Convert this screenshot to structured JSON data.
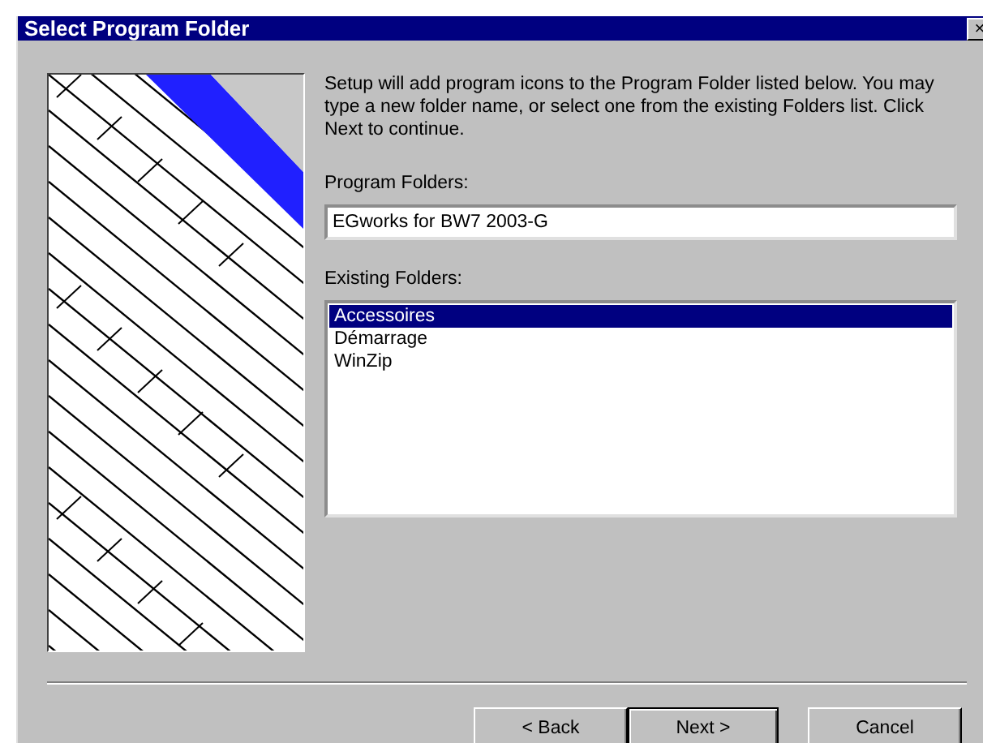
{
  "window": {
    "title": "Select Program Folder",
    "close": "×"
  },
  "intro": "Setup will add program icons to the Program Folder listed below. You may type a new folder name, or select one from the existing Folders list.  Click Next to continue.",
  "program_folder": {
    "label": "Program Folders:",
    "value": "EGworks for BW7 2003-G"
  },
  "existing_folders": {
    "label": "Existing Folders:",
    "items": [
      {
        "label": "Accessoires",
        "selected": true
      },
      {
        "label": "Démarrage",
        "selected": false
      },
      {
        "label": "WinZip",
        "selected": false
      }
    ]
  },
  "buttons": [
    {
      "label": "< Back",
      "default": false
    },
    {
      "label": "Next >",
      "default": true
    },
    {
      "label": "Cancel",
      "default": false
    }
  ]
}
